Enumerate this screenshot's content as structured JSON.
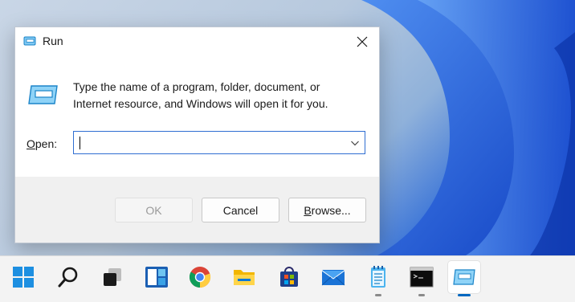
{
  "dialog": {
    "title": "Run",
    "description_line1": "Type the name of a program, folder, document, or",
    "description_line2": "Internet resource, and Windows will open it for you.",
    "open_label_mnemonic": "O",
    "open_label_rest": "pen:",
    "open_value": "",
    "ok_label": "OK",
    "cancel_label": "Cancel",
    "browse_mnemonic": "B",
    "browse_rest": "rowse..."
  },
  "taskbar": {
    "items": [
      {
        "name": "start-icon"
      },
      {
        "name": "search-icon"
      },
      {
        "name": "task-view-icon"
      },
      {
        "name": "widgets-icon"
      },
      {
        "name": "chrome-icon"
      },
      {
        "name": "file-explorer-icon"
      },
      {
        "name": "microsoft-store-icon"
      },
      {
        "name": "mail-icon"
      },
      {
        "name": "notepad-icon"
      },
      {
        "name": "command-prompt-icon"
      },
      {
        "name": "run-icon"
      }
    ]
  },
  "colors": {
    "accent": "#0067c0",
    "focus_border": "#2f6ed1",
    "footer_bg": "#f0f0f0"
  }
}
